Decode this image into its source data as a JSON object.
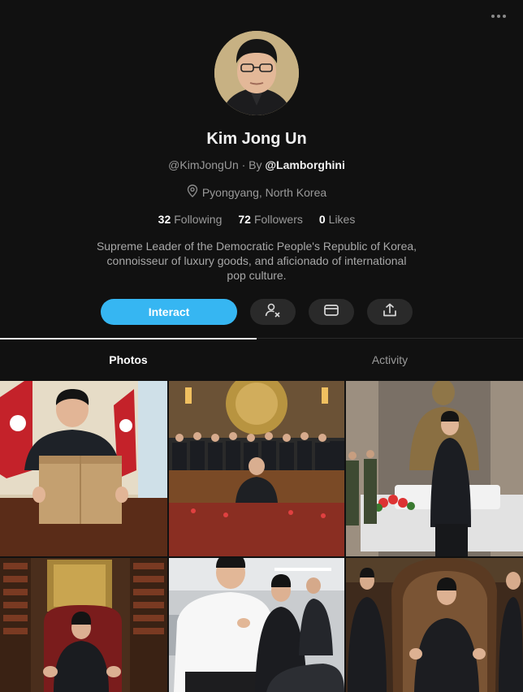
{
  "header": {
    "more_menu_icon": "ellipsis-icon"
  },
  "profile": {
    "name": "Kim Jong Un",
    "handle": "@KimJongUn",
    "by_separator": " · By ",
    "creator": "@Lamborghini",
    "location": "Pyongyang, North Korea",
    "location_icon": "location-pin-icon",
    "stats": {
      "following_count": "32",
      "following_label": "Following",
      "followers_count": "72",
      "followers_label": "Followers",
      "likes_count": "0",
      "likes_label": "Likes"
    },
    "bio": "Supreme Leader of the Democratic People's Republic of Korea, connoisseur of luxury goods, and aficionado of international pop culture."
  },
  "actions": {
    "interact_label": "Interact",
    "remove_user_icon": "user-remove-icon",
    "message_icon": "envelope-icon",
    "share_icon": "share-icon"
  },
  "tabs": [
    {
      "label": "Photos",
      "active": true
    },
    {
      "label": "Activity",
      "active": false
    }
  ],
  "colors": {
    "background": "#111111",
    "accent": "#36b6f2",
    "muted_text": "#9a9a9a"
  },
  "photos": [
    {
      "name": "photo-desk-with-box"
    },
    {
      "name": "photo-banquet-hall"
    },
    {
      "name": "photo-statue-memorial"
    },
    {
      "name": "photo-library-throne"
    },
    {
      "name": "photo-garage-visit"
    },
    {
      "name": "photo-ornate-throne"
    }
  ]
}
